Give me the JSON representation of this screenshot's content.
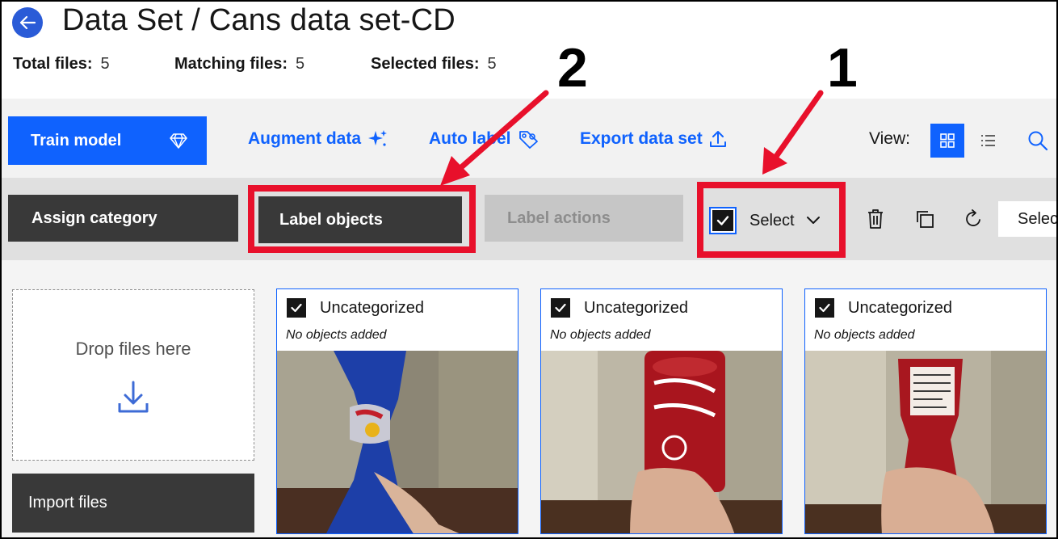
{
  "header": {
    "title": "Data Set / Cans data set-CD",
    "stats": [
      {
        "label": "Total files:",
        "value": "5"
      },
      {
        "label": "Matching files:",
        "value": "5"
      },
      {
        "label": "Selected files:",
        "value": "5"
      }
    ]
  },
  "toolbar": {
    "train_label": "Train model",
    "augment_label": "Augment data",
    "autolabel_label": "Auto label",
    "export_label": "Export data set",
    "view_label": "View:"
  },
  "actions": {
    "assign_label": "Assign category",
    "label_objects_label": "Label objects",
    "label_actions_label": "Label actions",
    "select_label": "Select",
    "select_dropdown_value": "Selec"
  },
  "dropzone": {
    "text": "Drop files here",
    "import_label": "Import files"
  },
  "cards": [
    {
      "category": "Uncategorized",
      "subtitle": "No objects added",
      "image": "red-bull-can-photo"
    },
    {
      "category": "Uncategorized",
      "subtitle": "No objects added",
      "image": "dr-pepper-can-photo"
    },
    {
      "category": "Uncategorized",
      "subtitle": "No objects added",
      "image": "nutrition-facts-can-photo"
    }
  ],
  "annotations": {
    "num_1": "1",
    "num_2": "2"
  },
  "colors": {
    "primary": "#0f62fe",
    "dark_button": "#393939",
    "highlight_red": "#e8102b",
    "back_button": "#2a5bd7"
  }
}
